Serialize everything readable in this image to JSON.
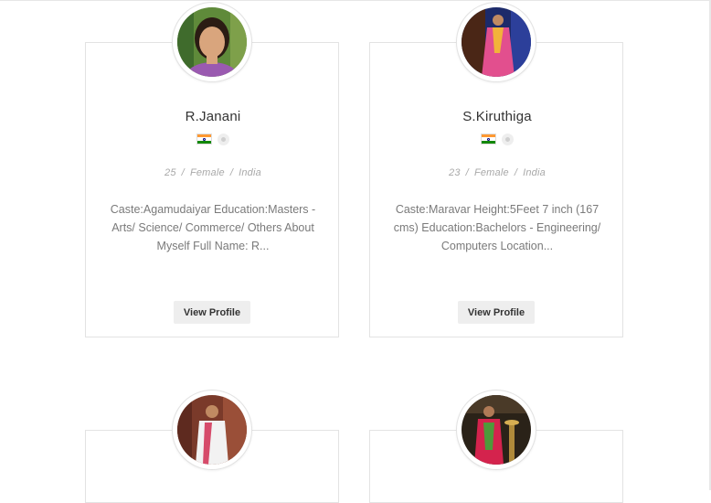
{
  "profiles": [
    {
      "name": "R.Janani",
      "age": "25",
      "gender": "Female",
      "country": "India",
      "description": "Caste:Agamudaiyar Education:Masters - Arts/ Science/ Commerce/ Others About Myself Full Name: R...",
      "button_label": "View Profile",
      "flag_icon": "india-flag-icon",
      "status_icon": "offline-status-icon"
    },
    {
      "name": "S.Kiruthiga",
      "age": "23",
      "gender": "Female",
      "country": "India",
      "description": "Caste:Maravar Height:5Feet 7 inch (167 cms) Education:Bachelors - Engineering/ Computers Location...",
      "button_label": "View Profile",
      "flag_icon": "india-flag-icon",
      "status_icon": "offline-status-icon"
    }
  ],
  "meta_separator": "/",
  "colors": {
    "name_text": "#333333",
    "meta_text": "#a8a8a8",
    "desc_text": "#7a7a7a",
    "button_bg": "#eeeeee",
    "card_border": "#e3e3e3"
  }
}
